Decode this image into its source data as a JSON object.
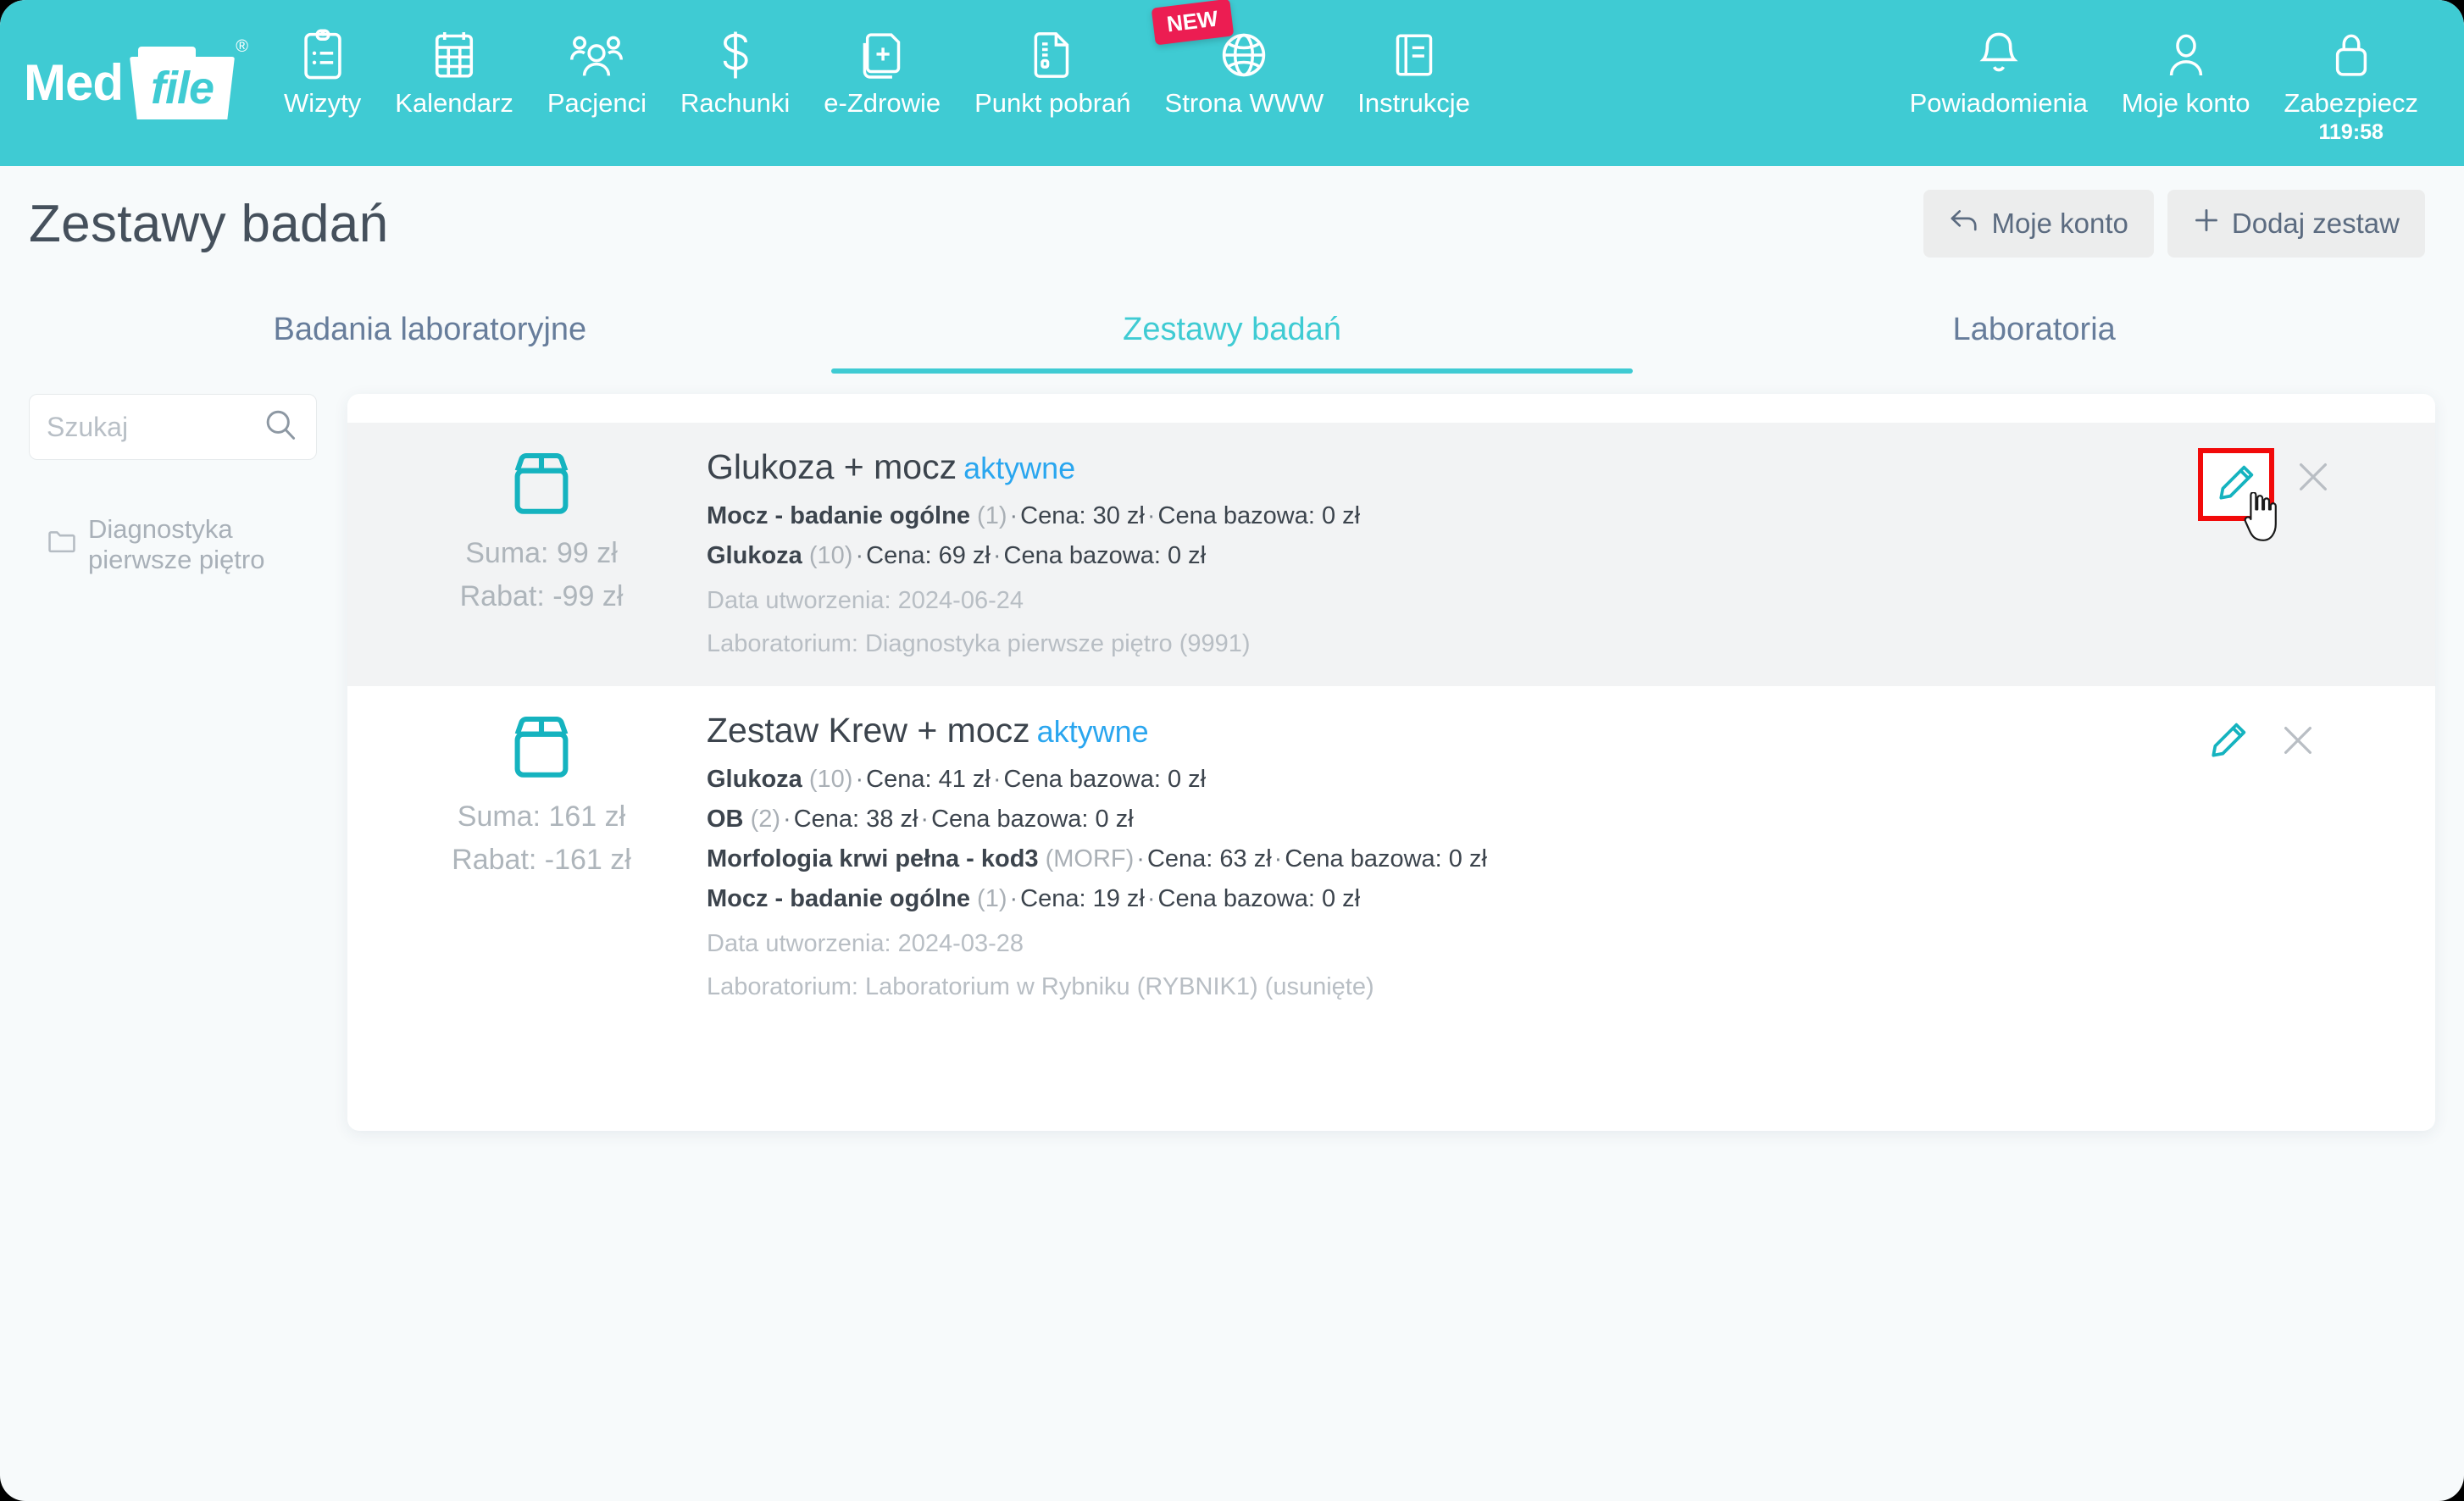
{
  "app": {
    "brand_first": "Med",
    "brand_second": "file",
    "brand_reg": "®"
  },
  "nav": {
    "left_items": [
      {
        "label": "Wizyty",
        "icon": "clipboard-icon"
      },
      {
        "label": "Kalendarz",
        "icon": "calendar-icon"
      },
      {
        "label": "Pacjenci",
        "icon": "people-icon"
      },
      {
        "label": "Rachunki",
        "icon": "dollar-icon"
      },
      {
        "label": "e-Zdrowie",
        "icon": "medical-file-icon"
      },
      {
        "label": "Punkt pobrań",
        "icon": "document-icon"
      },
      {
        "label": "Strona WWW",
        "icon": "globe-icon",
        "badge": "NEW"
      },
      {
        "label": "Instrukcje",
        "icon": "book-icon"
      }
    ],
    "right_items": [
      {
        "label": "Powiadomienia",
        "icon": "bell-icon"
      },
      {
        "label": "Moje konto",
        "icon": "user-icon"
      },
      {
        "label": "Zabezpiecz",
        "icon": "lock-icon",
        "sub": "119:58"
      }
    ]
  },
  "header": {
    "title": "Zestawy badań",
    "buttons": [
      {
        "label": "Moje konto",
        "icon": "back-arrow-icon"
      },
      {
        "label": "Dodaj zestaw",
        "icon": "plus-icon"
      }
    ]
  },
  "tabs": [
    {
      "label": "Badania laboratoryjne",
      "active": false
    },
    {
      "label": "Zestawy badań",
      "active": true
    },
    {
      "label": "Laboratoria",
      "active": false
    }
  ],
  "sidebar": {
    "search": {
      "value": "",
      "placeholder": "Szukaj",
      "icon": "search-icon"
    },
    "folders": [
      {
        "label": "Diagnostyka pierwsze piętro",
        "icon": "folder-icon"
      }
    ]
  },
  "sets": [
    {
      "icon": "package-box-icon",
      "suma": "Suma: 99 zł",
      "rabat": "Rabat: -99 zł",
      "title": "Glukoza + mocz",
      "status": "aktywne",
      "tests": [
        {
          "name": "Mocz - badanie ogólne",
          "code": "(1)",
          "price": "Cena: 30 zł",
          "base": "Cena bazowa: 0 zł"
        },
        {
          "name": "Glukoza",
          "code": "(10)",
          "price": "Cena: 69 zł",
          "base": "Cena bazowa: 0 zł"
        }
      ],
      "created": "Data utworzenia: 2024-06-24",
      "lab": "Laboratorium: Diagnostyka pierwsze piętro (9991)",
      "selected": true,
      "edit_highlighted": true,
      "edit_icon": "pencil-icon",
      "delete_icon": "close-x-icon"
    },
    {
      "icon": "package-box-icon",
      "suma": "Suma: 161 zł",
      "rabat": "Rabat: -161 zł",
      "title": "Zestaw Krew + mocz",
      "status": "aktywne",
      "tests": [
        {
          "name": "Glukoza",
          "code": "(10)",
          "price": "Cena: 41 zł",
          "base": "Cena bazowa: 0 zł"
        },
        {
          "name": "OB",
          "code": "(2)",
          "price": "Cena: 38 zł",
          "base": "Cena bazowa: 0 zł"
        },
        {
          "name": "Morfologia krwi pełna - kod3",
          "code": "(MORF)",
          "price": "Cena: 63 zł",
          "base": "Cena bazowa: 0 zł"
        },
        {
          "name": "Mocz - badanie ogólne",
          "code": "(1)",
          "price": "Cena: 19 zł",
          "base": "Cena bazowa: 0 zł"
        }
      ],
      "created": "Data utworzenia: 2024-03-28",
      "lab": "Laboratorium: Laboratorium w Rybniku (RYBNIK1) (usunięte)",
      "selected": false,
      "edit_highlighted": false,
      "edit_icon": "pencil-icon",
      "delete_icon": "close-x-icon"
    }
  ],
  "colors": {
    "brand": "#3fcbd3",
    "accent_blue": "#2aa6ef",
    "badge_new": "#ec1d52",
    "highlight": "#f20a0a"
  }
}
